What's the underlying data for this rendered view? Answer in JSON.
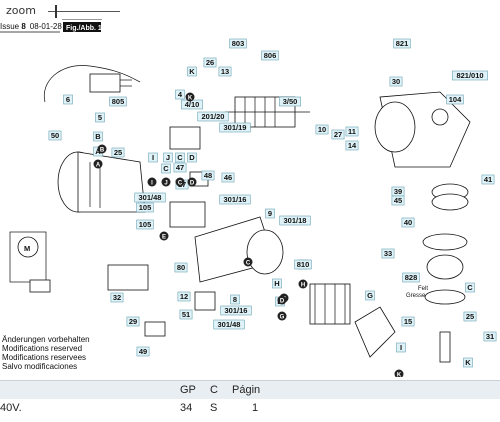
{
  "zoom": {
    "label": "zoom"
  },
  "diagram": {
    "issue_text": "Issue ",
    "issue_number": "8",
    "issue_date": "08-01-28",
    "fig_label": "Fig./Abb. 1",
    "modifications": [
      "Änderungen vorbehalten",
      "Modifications reserved",
      "Modifications reservees",
      "Salvo modificaciones"
    ],
    "felt_label": [
      "Felt",
      "Gresse"
    ],
    "part_labels": [
      "803",
      "821",
      "821/010",
      "104",
      "26",
      "13",
      "K",
      "806",
      "805",
      "6",
      "5",
      "4",
      "4/10",
      "3/50",
      "10",
      "27",
      "11",
      "14",
      "30",
      "201/20",
      "301/19",
      "50",
      "B",
      "A",
      "25",
      "I",
      "J",
      "C",
      "D",
      "39",
      "45",
      "41",
      "C",
      "47",
      "48",
      "46",
      "17",
      "301/48",
      "301/16",
      "105",
      "105",
      "9",
      "301/18",
      "3",
      "40",
      "33",
      "828",
      "C",
      "25",
      "80",
      "8",
      "301/16",
      "301/48",
      "810",
      "H",
      "D",
      "G",
      "29",
      "12",
      "15",
      "31",
      "49",
      "I",
      "K",
      "32",
      "51",
      "7"
    ],
    "letter_labels": [
      "K",
      "B",
      "A",
      "I",
      "J",
      "C",
      "D",
      "C",
      "C",
      "H",
      "D",
      "G",
      "K",
      "E",
      "I"
    ]
  },
  "table": {
    "headers": [
      "GP",
      "C",
      "Págin"
    ],
    "row": {
      "name": "40V.",
      "gp": "34",
      "c": "S",
      "page": "1"
    }
  }
}
